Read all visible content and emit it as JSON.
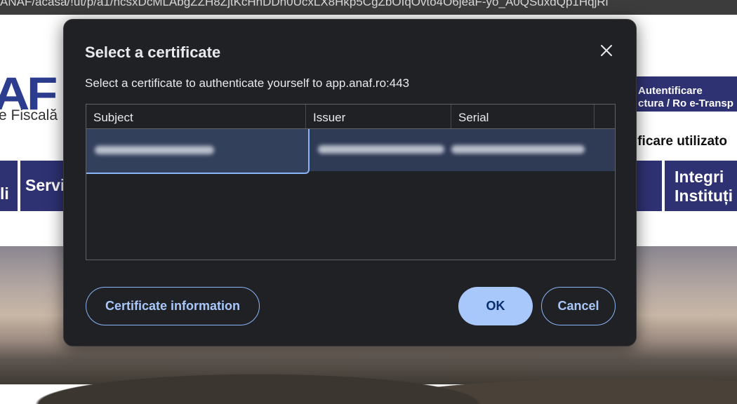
{
  "browser": {
    "url_fragment": "ANAF/acasa/!ut/p/a1/hcsxDcMLAbgZZH8ZjtKcHhDDh0UcxLX8Hkp5CgZbOIqOvto4O6jeaF-yo_A0QSuxdQp1HqjRl"
  },
  "background_page": {
    "logo": "AF",
    "logo_sub": "e Fiscală",
    "auth_box_line1": "Autentificare",
    "auth_box_line2": "ctura / Ro e-Transp",
    "auth_user": "ntificare utilizato",
    "nav": [
      "li",
      "Servi",
      "",
      "Integri",
      "Instituți"
    ]
  },
  "dialog": {
    "title": "Select a certificate",
    "subtitle": "Select a certificate to authenticate yourself to app.anaf.ro:443",
    "columns": [
      "Subject",
      "Issuer",
      "Serial"
    ],
    "rows_redacted": 1,
    "buttons": {
      "info": "Certificate information",
      "ok": "OK",
      "cancel": "Cancel"
    },
    "colors": {
      "background": "#202124",
      "accent": "#a8c7fa",
      "selected_row": "#2f3a55"
    }
  }
}
